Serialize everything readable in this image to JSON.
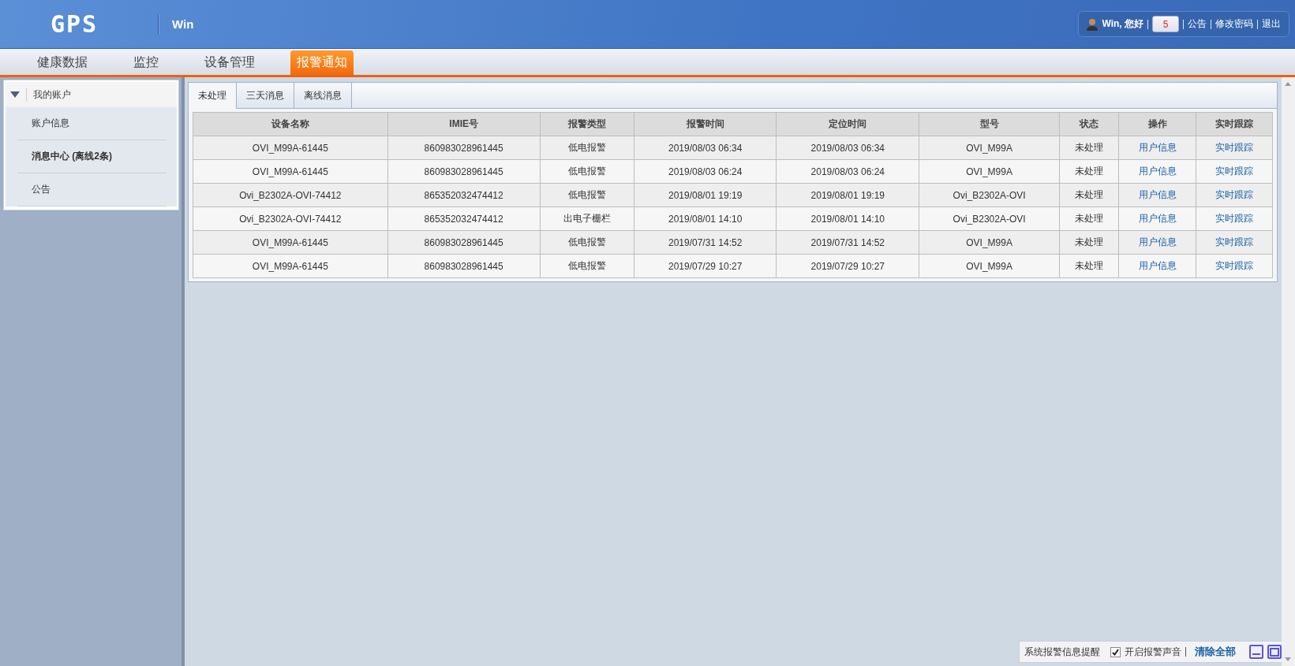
{
  "header": {
    "logo": "GPS",
    "account_name": "Win",
    "greeting": "Win, 您好",
    "alert_count": "5",
    "links": [
      "公告",
      "修改密码",
      "退出"
    ]
  },
  "nav_tabs": [
    {
      "label": "健康数据",
      "selected": false
    },
    {
      "label": "监控",
      "selected": false
    },
    {
      "label": "设备管理",
      "selected": false
    },
    {
      "label": "报警通知",
      "selected": true
    }
  ],
  "sidebar": {
    "title": "我的账户",
    "expanded": true,
    "items": [
      {
        "label": "账户信息",
        "selected": false
      },
      {
        "label": "消息中心 (离线2条)",
        "selected": true
      },
      {
        "label": "公告",
        "selected": false
      }
    ]
  },
  "tabs": [
    {
      "label": "未处理",
      "selected": true
    },
    {
      "label": "三天消息",
      "selected": false
    },
    {
      "label": "离线消息",
      "selected": false
    }
  ],
  "table": {
    "columns": [
      "设备名称",
      "IMIE号",
      "报警类型",
      "报警时间",
      "定位时间",
      "型号",
      "状态",
      "操作",
      "实时跟踪"
    ],
    "rows": [
      [
        "OVI_M99A-61445",
        "860983028961445",
        "低电报警",
        "2019/08/03 06:34",
        "2019/08/03 06:34",
        "OVI_M99A",
        "未处理",
        "用户信息",
        "实时跟踪"
      ],
      [
        "OVI_M99A-61445",
        "860983028961445",
        "低电报警",
        "2019/08/03 06:24",
        "2019/08/03 06:24",
        "OVI_M99A",
        "未处理",
        "用户信息",
        "实时跟踪"
      ],
      [
        "Ovi_B2302A-OVI-74412",
        "865352032474412",
        "低电报警",
        "2019/08/01 19:19",
        "2019/08/01 19:19",
        "Ovi_B2302A-OVI",
        "未处理",
        "用户信息",
        "实时跟踪"
      ],
      [
        "Ovi_B2302A-OVI-74412",
        "865352032474412",
        "出电子栅栏",
        "2019/08/01 14:10",
        "2019/08/01 14:10",
        "Ovi_B2302A-OVI",
        "未处理",
        "用户信息",
        "实时跟踪"
      ],
      [
        "OVI_M99A-61445",
        "860983028961445",
        "低电报警",
        "2019/07/31 14:52",
        "2019/07/31 14:52",
        "OVI_M99A",
        "未处理",
        "用户信息",
        "实时跟踪"
      ],
      [
        "OVI_M99A-61445",
        "860983028961445",
        "低电报警",
        "2019/07/29 10:27",
        "2019/07/29 10:27",
        "OVI_M99A",
        "未处理",
        "用户信息",
        "实时跟踪"
      ]
    ]
  },
  "alert_bar": {
    "title": "系统报警信息提醒",
    "sound_label": "开启报警声音",
    "sound_on": true,
    "clear_label": "清除全部"
  }
}
